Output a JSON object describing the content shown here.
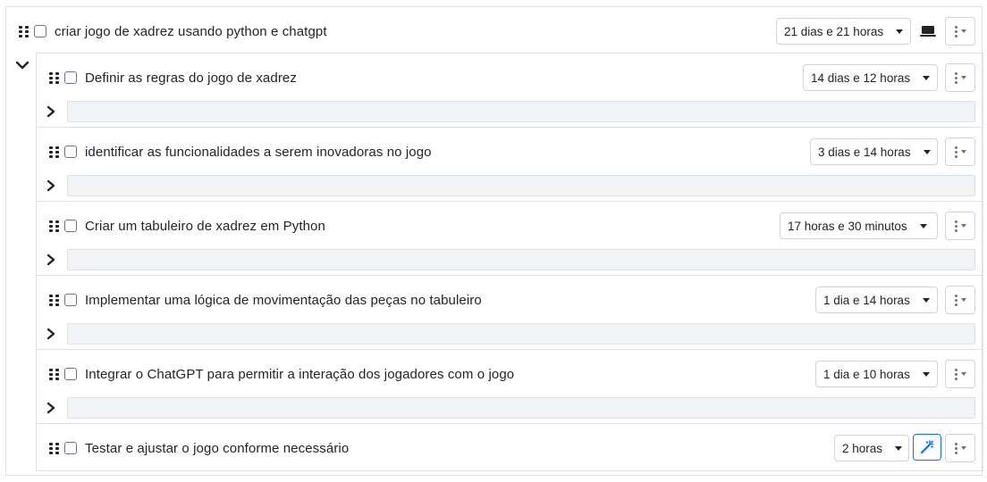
{
  "root_task": {
    "title": "criar jogo de xadrez usando python e chatgpt",
    "duration": "21 dias e 21 horas",
    "device_icon": "laptop-icon"
  },
  "subtasks": [
    {
      "title": "Definir as regras do jogo de xadrez",
      "duration": "14 dias e 12 horas",
      "input_value": ""
    },
    {
      "title": "identificar as funcionalidades a serem inovadoras no jogo",
      "duration": "3 dias e 14 horas",
      "input_value": ""
    },
    {
      "title": "Criar um tabuleiro de xadrez em Python",
      "duration": "17 horas e 30 minutos",
      "input_value": ""
    },
    {
      "title": "Implementar uma lógica de movimentação das peças no tabuleiro",
      "duration": "1 dia e 14 horas",
      "input_value": ""
    },
    {
      "title": "Integrar o ChatGPT para permitir a interação dos jogadores com o jogo",
      "duration": "1 dia e 10 horas",
      "input_value": ""
    },
    {
      "title": "Testar e ajustar o jogo conforme necessário",
      "duration": "2 horas",
      "action_icon": "magic-wand-icon"
    }
  ],
  "colors": {
    "accent": "#0d6efd",
    "border": "#dee2e6",
    "text": "#212529",
    "input_bg": "#f1f3f5"
  }
}
